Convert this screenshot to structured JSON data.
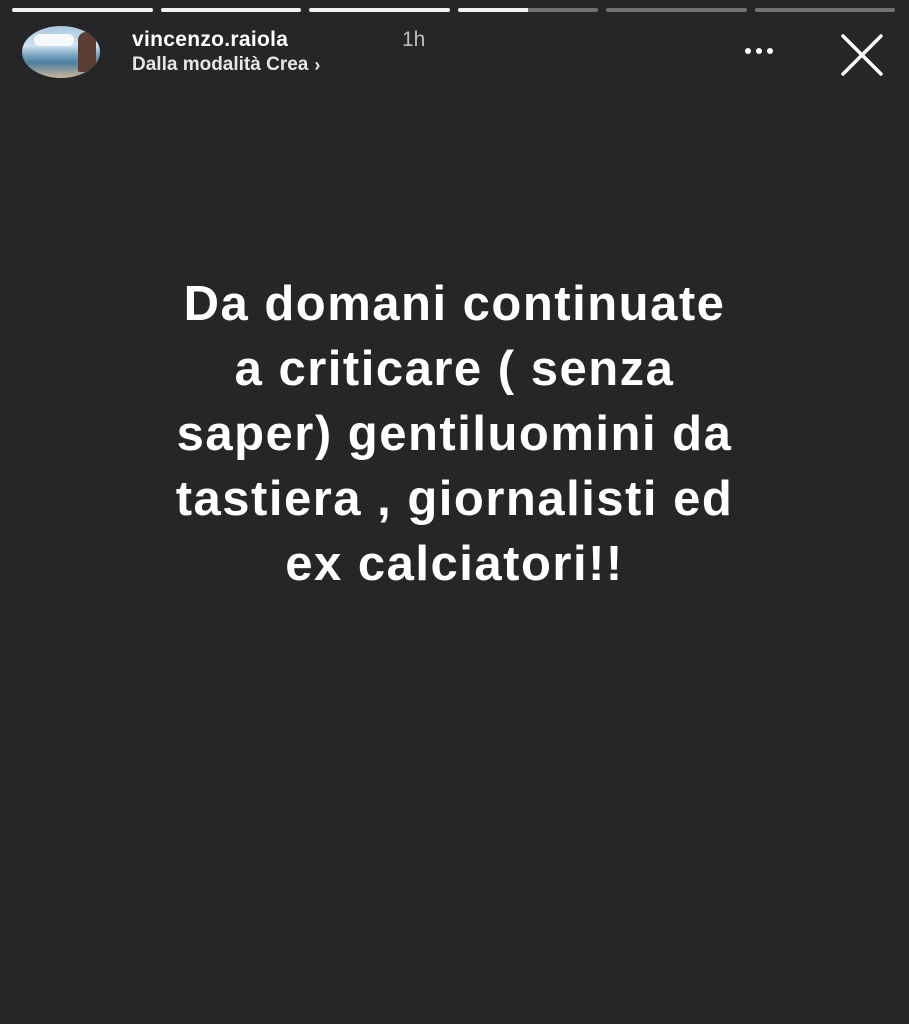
{
  "story": {
    "progress_segments": [
      1,
      1,
      1,
      0.5,
      0,
      0
    ],
    "account": {
      "username": "vincenzo.raiola",
      "time_ago": "1h",
      "subtitle": "Dalla modalità Crea",
      "subtitle_chevron": "›"
    },
    "actions": {
      "more_icon": "more-horizontal-icon",
      "close_icon": "close-icon"
    },
    "text": "Da domani continuate\na criticare ( senza\nsaper) gentiluomini da\ntastiera , giornalisti ed\nex calciatori!!"
  },
  "colors": {
    "background": "#262528",
    "text": "#ffffff",
    "secondary_text": "#bdbdbd"
  }
}
